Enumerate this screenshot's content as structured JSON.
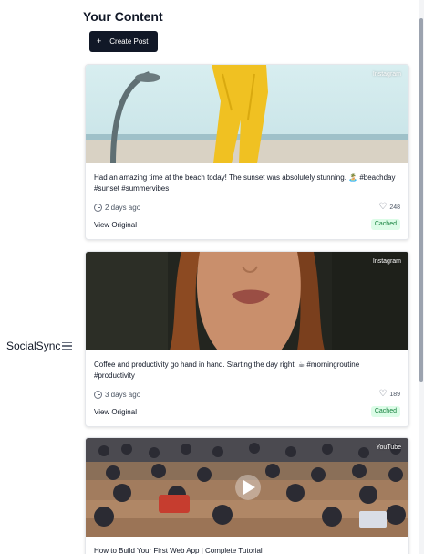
{
  "sidebar": {
    "brand": "SocialSync",
    "menu_icon": "hamburger-menu-icon"
  },
  "header": {
    "title": "Your Content",
    "create_label": "Create Post",
    "create_icon": "plus-icon"
  },
  "posts": [
    {
      "platform": "Instagram",
      "caption": "Had an amazing time at the beach today! The sunset was absolutely stunning. 🏝️ #beachday #sunset #summervibes",
      "time": "2 days ago",
      "likes": "248",
      "view_label": "View Original",
      "status": "Cached"
    },
    {
      "platform": "Instagram",
      "caption": "Coffee and productivity go hand in hand. Starting the day right! ☕ #morningroutine #productivity",
      "time": "3 days ago",
      "likes": "189",
      "view_label": "View Original",
      "status": "Cached"
    },
    {
      "platform": "YouTube",
      "caption": "How to Build Your First Web App | Complete Tutorial",
      "time": "",
      "likes": "",
      "view_label": "",
      "status": ""
    }
  ],
  "colors": {
    "primary_button": "#111827",
    "badge_bg": "#dcfce7",
    "badge_text": "#15803d"
  }
}
